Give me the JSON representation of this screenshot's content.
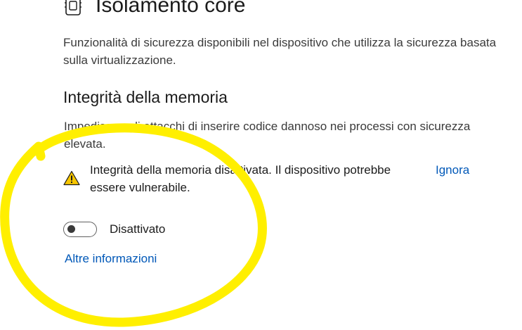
{
  "header": {
    "title": "Isolamento core",
    "icon": "core-isolation-icon"
  },
  "description": "Funzionalità di sicurezza disponibili nel dispositivo che utilizza la sicurezza basata sulla virtualizzazione.",
  "memory_integrity": {
    "title": "Integrità della memoria",
    "description": "Impedisce agli attacchi di inserire codice dannoso nei processi con sicurezza elevata.",
    "warning": {
      "icon": "warning-icon",
      "text": "Integrità della memoria disattivata. Il dispositivo potrebbe essere vulnerabile.",
      "ignore_label": "Ignora"
    },
    "toggle": {
      "state": "off",
      "label": "Disattivato"
    },
    "more_info_label": "Altre informazioni"
  },
  "colors": {
    "link": "#0058b8",
    "warning_fill": "#f7c600",
    "annotation": "#ffef00"
  }
}
